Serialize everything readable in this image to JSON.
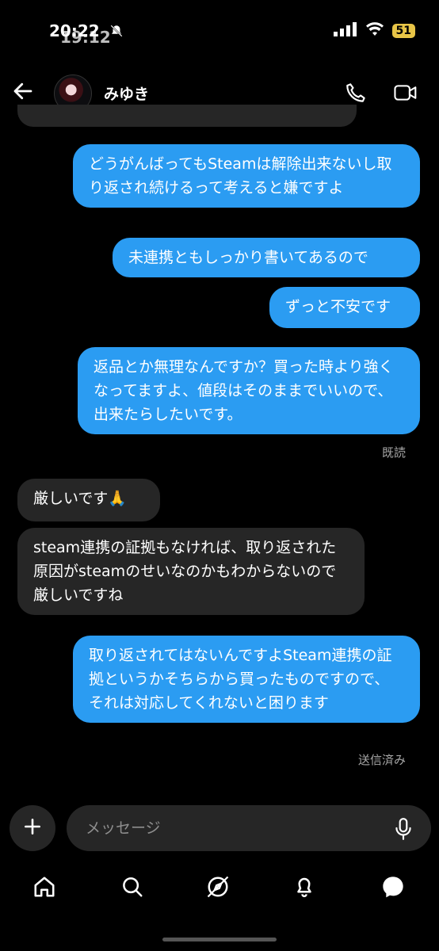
{
  "status_bar": {
    "time_top": "20:22",
    "time_under": "19:12",
    "battery": "51"
  },
  "header": {
    "contact_name": "みゆき"
  },
  "messages": [
    {
      "text": "どうがんばってもSteamは解除出来ないし取り返され続けるって考えると嫌ですよ"
    },
    {
      "text": "未連携ともしっかり書いてあるので"
    },
    {
      "text": "ずっと不安です"
    },
    {
      "text": "返品とか無理なんですか？買った時より強くなってますよ、値段はそのままでいいので、出来たらしたいです。"
    },
    {
      "text": "厳しいです🙏"
    },
    {
      "text": "steam連携の証拠もなければ、取り返された原因がsteamのせいなのかもわからないので厳しいですね"
    },
    {
      "text": "取り返されてはないんですよSteam連携の証拠というかそちらから買ったものですので、それは対応してくれないと困ります"
    }
  ],
  "read_receipt": "既読",
  "sent_status": "送信済み",
  "composer": {
    "placeholder": "メッセージ"
  },
  "icons": [
    "back-arrow-icon",
    "phone-icon",
    "video-camera-icon",
    "plus-icon",
    "microphone-icon",
    "home-icon",
    "search-icon",
    "explore-icon",
    "heart-icon",
    "messenger-icon"
  ]
}
